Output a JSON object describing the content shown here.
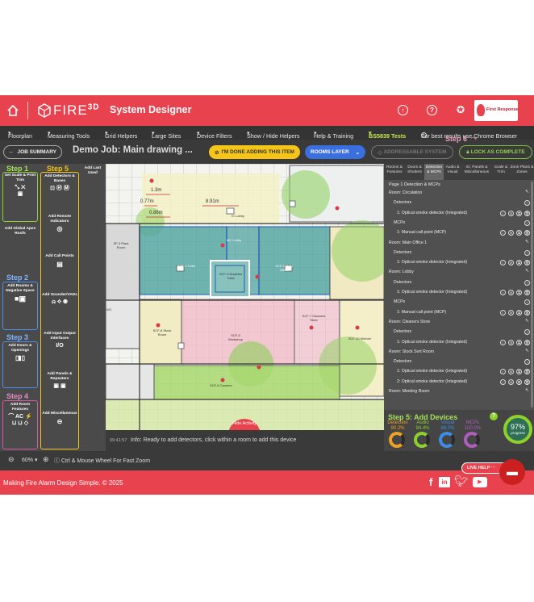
{
  "header": {
    "brand": "FIRE",
    "brand_sup": "3D",
    "title": "System Designer",
    "partner_logo_text": "First Response"
  },
  "menu": {
    "items": [
      "Floorplan",
      "Measuring Tools",
      "Grid Helpers",
      "Large Sites",
      "Device Filters",
      "Show / Hide Helpers",
      "Help & Training",
      "BS5839 Tests"
    ],
    "hint": "For best results use Chrome Browser"
  },
  "toolbar": {
    "job_summary": "JOB SUMMARY",
    "job_title": "Demo Job: Main drawing ...",
    "done_button": "I'M DONE ADDING THIS ITEM",
    "rooms_layer": "ROOMS LAYER",
    "addressable": "ADDRESSABLE SYSTEM",
    "lock": "LOCK AS COMPLETE",
    "step6": "Step 6"
  },
  "left": {
    "step1": "Step 1",
    "step2": "Step 2",
    "step3": "Step 3",
    "step4": "Step 4",
    "step5": "Step 5",
    "add_last_used": "Add Last Used",
    "tools": {
      "set_scale": "Set Scale & Print Trim",
      "global_apex": "Add Global Apex Roofs",
      "rooms_negative": "Add Rooms & Negative Space",
      "doors": "Add Doors & Openings",
      "room_features": "Add Room Features",
      "detectors": "Add Detectors & Bases",
      "remote": "Add Remote Indicators",
      "call_points": "Add Call Points",
      "sounders": "Add Sounder/VADs",
      "io": "Add Input Output Interfaces",
      "io_label": "I/O",
      "panels": "Add Panels & Repeaters",
      "misc": "Add Miscellaneous"
    }
  },
  "canvas": {
    "labels": [
      "1.3m",
      "0.77m",
      "8.91m",
      "0.86m",
      "SF-3 Plant Room",
      "MC Lobby",
      "SCF-4 Toilet",
      "SCF-3 Main Office",
      "SCF-9 Disabled Toilet",
      "SCF-8 Stock Room",
      "SCF-7 Cleaners Store",
      "SCF-5 Workshop",
      "SCF-6 Canteen",
      "SCF-10 Kitchen",
      "IC Lobby",
      "WC"
    ],
    "hide_activity": "Hide Activity"
  },
  "status": {
    "time": "09:41:57",
    "message": "Info: Ready to add detectors, click within a room to add this device"
  },
  "right": {
    "tabs": [
      "Rooms & Features",
      "Doors & Shutters",
      "Detection & MCPs",
      "Audio & Visual",
      "IO, Panels & Miscellaneous",
      "Scale & Trim",
      "Zone Plans & Zones"
    ],
    "active_tab": 2,
    "heading": "Page 1 Detection & MCPs",
    "rows": [
      {
        "kind": "room",
        "text": "Room: Circulation"
      },
      {
        "kind": "sub",
        "text": "Detectors"
      },
      {
        "kind": "item",
        "text": "1: Optical smoke detector (Integrated)"
      },
      {
        "kind": "sub",
        "text": "MCPs"
      },
      {
        "kind": "item",
        "text": "1: Manual call point (MCP)"
      },
      {
        "kind": "room",
        "text": "Room: Main Office 1"
      },
      {
        "kind": "sub",
        "text": "Detectors"
      },
      {
        "kind": "item",
        "text": "1: Optical smoke detector (Integrated)"
      },
      {
        "kind": "room",
        "text": "Room: Lobby"
      },
      {
        "kind": "sub",
        "text": "Detectors"
      },
      {
        "kind": "item",
        "text": "1: Optical smoke detector (Integrated)"
      },
      {
        "kind": "sub",
        "text": "MCPs"
      },
      {
        "kind": "item",
        "text": "1: Manual call point (MCP)"
      },
      {
        "kind": "room",
        "text": "Room: Cleaners Store"
      },
      {
        "kind": "sub",
        "text": "Detectors"
      },
      {
        "kind": "item",
        "text": "1: Optical smoke detector (Integrated)"
      },
      {
        "kind": "room",
        "text": "Room: Stock Sort Room"
      },
      {
        "kind": "sub",
        "text": "Detectors"
      },
      {
        "kind": "item",
        "text": "1: Optical smoke detector (Integrated)"
      },
      {
        "kind": "item",
        "text": "2: Optical smoke detector (Integrated)"
      },
      {
        "kind": "room",
        "text": "Room: Meeting Room"
      }
    ]
  },
  "step5": {
    "title": "Step 5: Add Devices",
    "gauges": [
      {
        "label": "Detection",
        "value": "90.2%",
        "color": "#f0a020"
      },
      {
        "label": "Audio",
        "value": "94.4%",
        "color": "#8ed12a"
      },
      {
        "label": "Visual",
        "value": "88.0%",
        "color": "#3a8ee6"
      },
      {
        "label": "MCPs",
        "value": "100.0%",
        "color": "#b05cc0"
      }
    ],
    "progress_value": "97%",
    "progress_label": "progress"
  },
  "zoom": {
    "value": "60%",
    "hint": "Ctrl & Mouse Wheel For Fast Zoom"
  },
  "footer": {
    "text": "Making Fire Alarm Design Simple. © 2025",
    "live_help": "LIVE HELP"
  },
  "colors": {
    "brand_red": "#e9424f",
    "yellow": "#f5c518",
    "blue": "#3b6fe0",
    "green_room": "#8ccf5a",
    "teal_room": "#4fa3a0",
    "pink_room": "#f2b8c6"
  }
}
